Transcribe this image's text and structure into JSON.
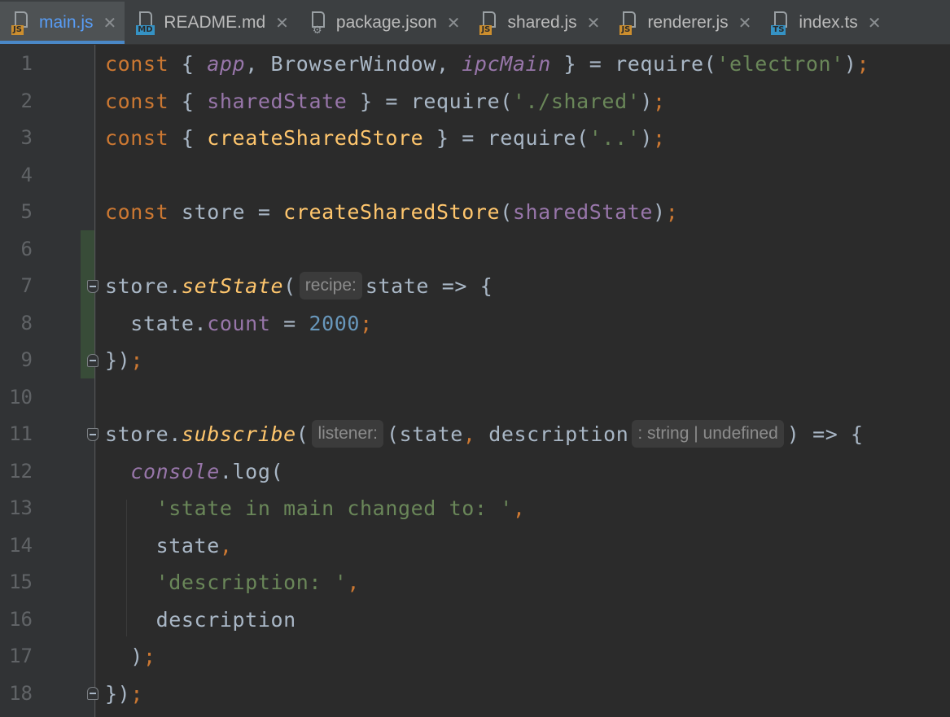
{
  "tabs": [
    {
      "label": "main.js",
      "icon": "js-file-icon",
      "badge": "JS",
      "badge_color": "#cc8e2e",
      "active": true
    },
    {
      "label": "README.md",
      "icon": "markdown-file-icon",
      "badge": "MD",
      "badge_color": "#3592c4",
      "active": false
    },
    {
      "label": "package.json",
      "icon": "json-file-icon",
      "badge": "{}",
      "badge_color": "#9aa0a4",
      "active": false
    },
    {
      "label": "shared.js",
      "icon": "js-file-icon",
      "badge": "JS",
      "badge_color": "#cc8e2e",
      "active": false
    },
    {
      "label": "renderer.js",
      "icon": "js-file-icon",
      "badge": "JS",
      "badge_color": "#cc8e2e",
      "active": false
    },
    {
      "label": "index.ts",
      "icon": "ts-file-icon",
      "badge": "TS",
      "badge_color": "#3592c4",
      "active": false
    }
  ],
  "line_numbers": [
    "1",
    "2",
    "3",
    "4",
    "5",
    "6",
    "7",
    "8",
    "9",
    "10",
    "11",
    "12",
    "13",
    "14",
    "15",
    "16",
    "17",
    "18"
  ],
  "code": {
    "l1": {
      "kw": "const",
      "t1": " { ",
      "app": "app",
      "t2": ", BrowserWindow, ",
      "ipc": "ipcMain",
      "t3": " } = require(",
      "str": "'electron'",
      "t4": ")",
      "semi": ";"
    },
    "l2": {
      "kw": "const",
      "t1": " { ",
      "var": "sharedState",
      "t2": " } = require(",
      "str": "'./shared'",
      "t3": ")",
      "semi": ";"
    },
    "l3": {
      "kw": "const",
      "t1": " { ",
      "fn": "createSharedStore",
      "t2": " } = require(",
      "str": "'..'",
      "t3": ")",
      "semi": ";"
    },
    "l5": {
      "kw": "const",
      "t1": " store = ",
      "fn": "createSharedStore",
      "t2": "(",
      "var": "sharedState",
      "t3": ")",
      "semi": ";"
    },
    "l7": {
      "t1": "store.",
      "fn": "setState",
      "t2": "(",
      "hint": "recipe:",
      "t3": "state => {"
    },
    "l8": {
      "t1": "  state.",
      "prop": "count",
      "t2": " = ",
      "num": "2000",
      "semi": ";"
    },
    "l9": {
      "t1": "})",
      "semi": ";"
    },
    "l11": {
      "t1": "store.",
      "fn": "subscribe",
      "t2": "(",
      "hint": "listener:",
      "t3": "(state",
      "comma": ",",
      "t4": " description",
      "hint2": ": string | undefined",
      "t5": ") => {"
    },
    "l12": {
      "t1": "  ",
      "obj": "console",
      "t2": ".log("
    },
    "l13": {
      "t1": "    ",
      "str": "'state in main changed to: '",
      "comma": ","
    },
    "l14": {
      "t1": "    state",
      "comma": ","
    },
    "l15": {
      "t1": "    ",
      "str": "'description: '",
      "comma": ","
    },
    "l16": {
      "t1": "    description"
    },
    "l17": {
      "t1": "  )",
      "semi": ";"
    },
    "l18": {
      "t1": "})",
      "semi": ";"
    }
  }
}
